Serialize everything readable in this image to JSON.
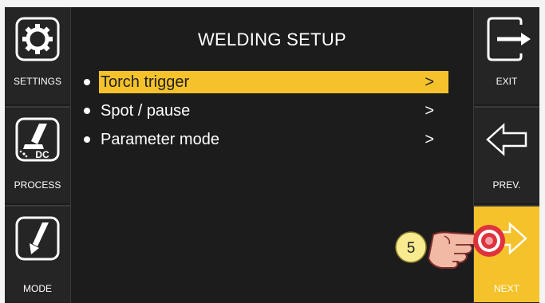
{
  "title": "WELDING SETUP",
  "left_buttons": [
    {
      "label": "SETTINGS",
      "icon": "gear-icon"
    },
    {
      "label": "PROCESS",
      "icon": "welding-torch-icon",
      "badge": "DC"
    },
    {
      "label": "MODE",
      "icon": "torch-mode-icon"
    }
  ],
  "right_buttons": [
    {
      "label": "EXIT",
      "icon": "exit-arrow-icon"
    },
    {
      "label": "PREV.",
      "icon": "arrow-left-icon"
    },
    {
      "label": "NEXT",
      "icon": "arrow-right-icon",
      "active": true
    }
  ],
  "menu": [
    {
      "label": "Torch trigger",
      "arrow": ">",
      "selected": true
    },
    {
      "label": "Spot / pause",
      "arrow": ">"
    },
    {
      "label": "Parameter mode",
      "arrow": ">"
    }
  ],
  "callout": {
    "number": "5"
  },
  "colors": {
    "accent": "#f5c22b",
    "background": "#1c1c1c",
    "callout_red": "#e0323c"
  }
}
